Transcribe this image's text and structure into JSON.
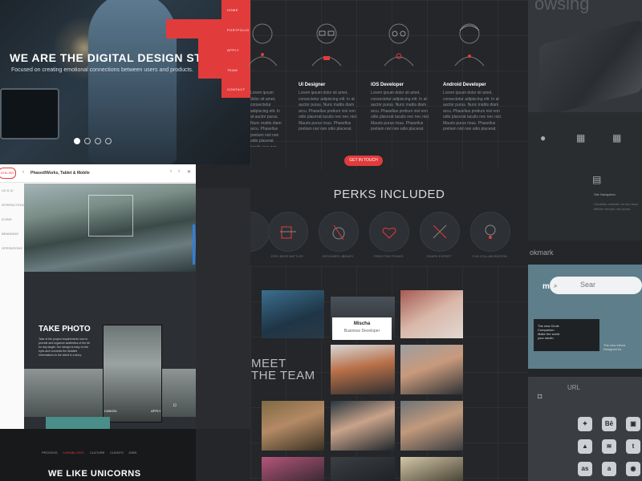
{
  "hero": {
    "title": "WE ARE THE DIGITAL DESIGN STUDIO",
    "subtitle": "Focused on creating emotional connections between users and products."
  },
  "nav": [
    "HOME",
    "PORTFOLIO",
    "APPLY",
    "TEAM",
    "CONTACT"
  ],
  "roles": [
    {
      "title": "",
      "text": "Lorem ipsum dolor sit amet, consectetur adipiscing elit. In at auctor purus. Nunc mattis diam arcu. Phasellus pretium nisl non odio placerat iaculis nec nec nisl. Mauris purus risus."
    },
    {
      "title": "UI Designer",
      "text": "Lorem ipsum dolor sit amet, consectetur adipiscing elit. In at auctor purus. Nunc mattis diam arcu. Phasellus pretium nisl non odio placerat iaculis nec nec nisl. Mauris purus risus. Phasellus pretium nisl non odio placerat."
    },
    {
      "title": "iOS Developer",
      "text": "Lorem ipsum dolor sit amet, consectetur adipiscing elit. In at auctor purus. Nunc mattis diam arcu. Phasellus pretium nisl non odio placerat iaculis nec nec nisl. Mauris purus risus. Phasellus pretium nisl non odio placerat."
    },
    {
      "title": "Android Developer",
      "text": "Lorem ipsum dolor sit amet, consectetur adipiscing elit. In at auctor purus. Nunc mattis diam arcu. Phasellus pretium nisl non odio placerat iaculis nec nec nisl. Mauris purus risus. Phasellus pretium nisl non odio placerat."
    }
  ],
  "cta": "GET IN TOUCH",
  "perks": {
    "title": "PERKS INCLUDED",
    "items": [
      "",
      "EPIC BEER BATTLES",
      "DESIGNER LIBRARY",
      "FREE PING PONGS",
      "GEARS EXPERT",
      "FUN COLLABORATION"
    ]
  },
  "meet": {
    "title_line1": "MEET",
    "title_line2": "THE TEAM",
    "card_name": "Mischa",
    "card_role": "Business Developer"
  },
  "app": {
    "brand": "ATELIER",
    "header_title": "Phased/Works, Tablet & Mobile",
    "side_items": [
      "UX & UI",
      "INTERACTIONS",
      "ICONS",
      "BRANDING",
      "OPERATIONS"
    ],
    "take_photo": "TAKE PHOTO",
    "take_text": "Take of the project requirements how to provide and organize aesthetics of the kit for any target. Our design is easy on the eyes and connects the detailed informations to the client in a story.",
    "cancel": "CANCEL",
    "apply": "APPLY"
  },
  "bottom": {
    "nav": [
      "PROCESS",
      "CAPABILITIES",
      "CULTURE",
      "CLIENTS",
      "JOBS"
    ],
    "active_index": 1,
    "headline": "WE LIKE UNICORNS"
  },
  "right": {
    "browsing": "owsing",
    "site_navigation": "Site Navigation",
    "bookmark": "okmark",
    "search": "Sear",
    "url": "URL",
    "promo_line1": "The new Circle",
    "promo_line2": "Companion.",
    "promo_line3": "Make the world",
    "promo_line4": "your studio",
    "promo2_line1": "The new Intuos",
    "promo2_line2": "Designed for"
  },
  "colors": {
    "accent": "#e23b3b",
    "bg": "#242629",
    "app_bg": "#fafafa"
  }
}
